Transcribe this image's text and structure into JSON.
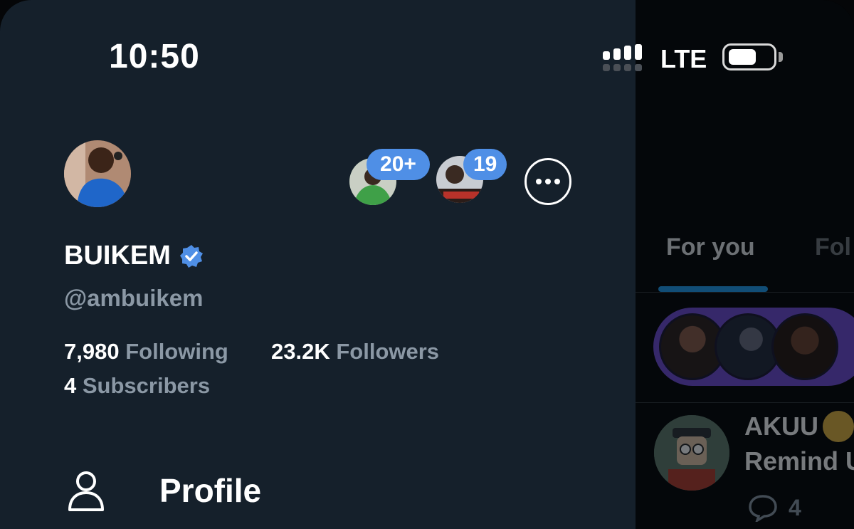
{
  "status_bar": {
    "time": "10:50",
    "network": "LTE"
  },
  "drawer": {
    "display_name": "BUIKEM",
    "handle": "@ambuikem",
    "stats": {
      "following_count": "7,980",
      "following_label": "Following",
      "followers_count": "23.2K",
      "followers_label": "Followers",
      "subscribers_count": "4",
      "subscribers_label": "Subscribers"
    },
    "other_accounts": [
      {
        "badge": "20+"
      },
      {
        "badge": "19"
      }
    ],
    "nav": {
      "profile_label": "Profile"
    }
  },
  "timeline": {
    "tabs": [
      {
        "label": "For you"
      },
      {
        "label": "Fol"
      }
    ],
    "post": {
      "author": "AKUU",
      "text": "Remind U",
      "reply_count": "4"
    }
  },
  "colors": {
    "drawer_bg": "#15202b",
    "accent": "#1d9bf0",
    "badge": "#4f8fe6",
    "verified": "#4f8fe6",
    "spaces": "#6f4ad6"
  },
  "icons": [
    "signal-icon",
    "battery-icon",
    "verified-badge-icon",
    "more-icon",
    "person-icon",
    "reply-icon"
  ]
}
